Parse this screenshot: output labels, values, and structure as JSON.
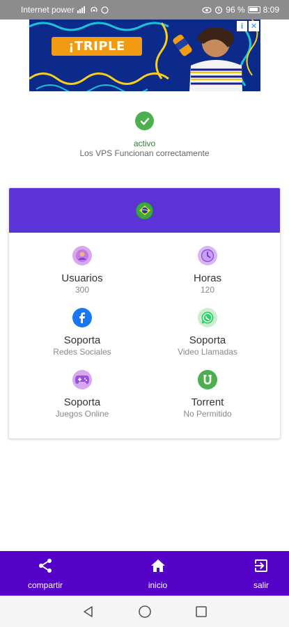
{
  "status_bar": {
    "carrier": "Internet power",
    "battery": "96 %",
    "time": "8:09"
  },
  "ad": {
    "brand_text": "¡TRIPLE",
    "info_icon": "info-icon",
    "close_icon": "close-icon"
  },
  "server_status": {
    "label": "activo",
    "message": "Los VPS Funcionan correctamente"
  },
  "card": {
    "flag": "brazil-flag",
    "features": [
      {
        "icon": "user-icon",
        "title": "Usuarios",
        "value": "300"
      },
      {
        "icon": "clock-icon",
        "title": "Horas",
        "value": "120"
      },
      {
        "icon": "facebook-icon",
        "title": "Soporta",
        "value": "Redes Sociales"
      },
      {
        "icon": "whatsapp-icon",
        "title": "Soporta",
        "value": "Video Llamadas"
      },
      {
        "icon": "gamepad-icon",
        "title": "Soporta",
        "value": "Juegos Online"
      },
      {
        "icon": "torrent-icon",
        "title": "Torrent",
        "value": "No Permitido"
      }
    ]
  },
  "bottom_nav": {
    "share": "compartir",
    "home": "inicio",
    "exit": "salir"
  },
  "colors": {
    "primary": "#5603c9",
    "header": "#5b33d6",
    "active": "#4caf50"
  }
}
